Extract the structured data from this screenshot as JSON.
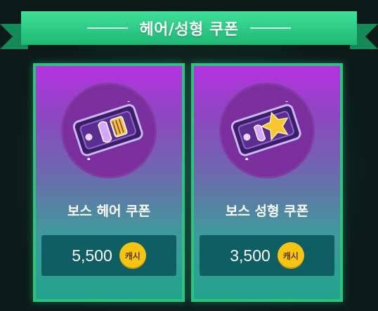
{
  "banner": {
    "title": "헤어/성형 쿠폰"
  },
  "cards": [
    {
      "name": "보스 헤어 쿠폰",
      "price": "5,500",
      "currency": "캐시",
      "icon": "hair-coupon-icon"
    },
    {
      "name": "보스 성형 쿠폰",
      "price": "3,500",
      "currency": "캐시",
      "icon": "plastic-surgery-coupon-icon"
    }
  ],
  "colors": {
    "banner": "#2fd08b",
    "card_border": "#2ec27e",
    "price_box": "#0f5e64",
    "cash_badge": "#f6c514"
  }
}
